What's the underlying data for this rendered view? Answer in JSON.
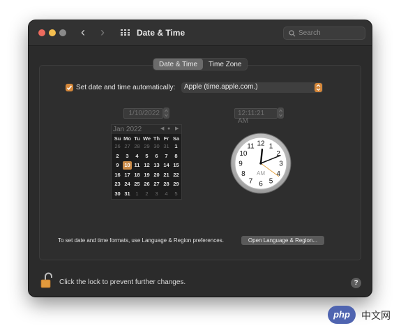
{
  "window": {
    "title": "Date & Time",
    "search_placeholder": "Search",
    "traffic_light_colors": [
      "#ec6b5e",
      "#f4be4f",
      "#8a8a8a"
    ]
  },
  "tabs": [
    {
      "label": "Date & Time",
      "active": true
    },
    {
      "label": "Time Zone",
      "active": false
    }
  ],
  "auto": {
    "checked": true,
    "label": "Set date and time automatically:",
    "server": "Apple (time.apple.com.)"
  },
  "date_field": "1/10/2022",
  "time_field": "12:11:21 AM",
  "calendar": {
    "month": "Jan 2022",
    "nav_prev": "◀",
    "nav_today": "●",
    "nav_next": "▶",
    "weekdays": [
      "Su",
      "Mo",
      "Tu",
      "We",
      "Th",
      "Fr",
      "Sa"
    ],
    "weeks": [
      [
        "26",
        "27",
        "28",
        "29",
        "30",
        "31",
        "1"
      ],
      [
        "2",
        "3",
        "4",
        "5",
        "6",
        "7",
        "8"
      ],
      [
        "9",
        "10",
        "11",
        "12",
        "13",
        "14",
        "15"
      ],
      [
        "16",
        "17",
        "18",
        "19",
        "20",
        "21",
        "22"
      ],
      [
        "23",
        "24",
        "25",
        "26",
        "27",
        "28",
        "29"
      ],
      [
        "30",
        "31",
        "1",
        "2",
        "3",
        "4",
        "5"
      ]
    ],
    "selected": "10"
  },
  "clock": {
    "numbers": [
      "12",
      "1",
      "2",
      "3",
      "4",
      "5",
      "6",
      "7",
      "8",
      "9",
      "10",
      "11"
    ],
    "ampm": "AM",
    "hours": 12,
    "minutes": 11,
    "seconds": 21
  },
  "footer": {
    "note": "To set date and time formats, use Language & Region preferences.",
    "open_button": "Open Language & Region...",
    "lock_text": "Click the lock to prevent further changes.",
    "help": "?"
  },
  "watermark": {
    "logo": "php",
    "text": "中文网"
  },
  "colors": {
    "accent": "#d4873a",
    "selected_day": "#c98a47"
  }
}
